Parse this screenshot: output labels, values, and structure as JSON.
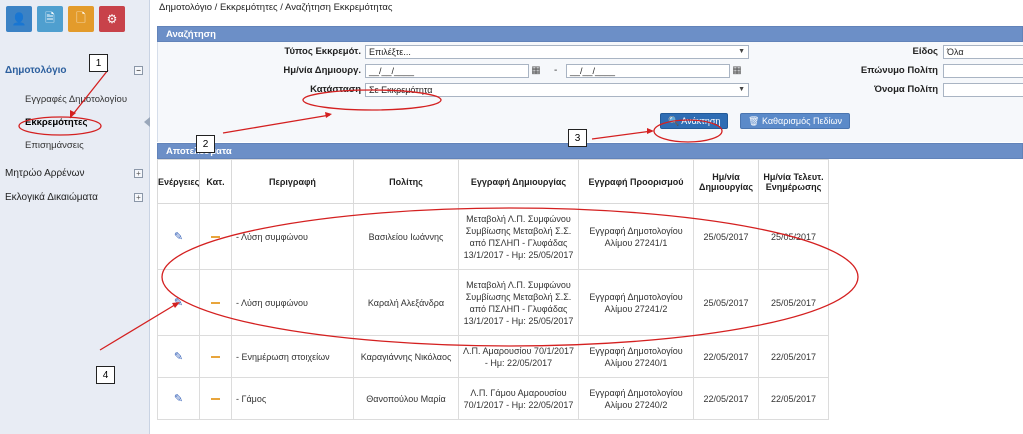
{
  "sidebar": {
    "top_icons": [
      {
        "icon": "user-icon",
        "glyph": "👤",
        "color": "blue"
      },
      {
        "icon": "document-icon",
        "glyph": "🗎",
        "color": "teal"
      },
      {
        "icon": "file-icon",
        "glyph": "🗋",
        "color": "orange"
      },
      {
        "icon": "settings-icon",
        "glyph": "⚙",
        "color": "red"
      }
    ],
    "main_menu_label": "Δημοτολόγιο",
    "sub_items": [
      {
        "label": "Εγγραφές Δημοτολογίου"
      },
      {
        "label": "Εκκρεμότητες"
      },
      {
        "label": "Επισημάνσεις"
      }
    ],
    "other_menus": [
      {
        "label": "Μητρώο Αρρένων"
      },
      {
        "label": "Εκλογικά Δικαιώματα"
      }
    ],
    "toggle_sign": "⊟",
    "toggle_plus": "⊞"
  },
  "breadcrumb": {
    "item1": "Δημοτολόγιο",
    "sep": "/",
    "item2": "Εκκρεμότητες",
    "item3": "Αναζήτηση Εκκρεμότητας"
  },
  "search": {
    "header": "Αναζήτηση",
    "type_label": "Τύπος Εκκρεμότ.",
    "type_value": "Επιλέξτε...",
    "date_label": "Ημ/νία Δημιουργ.",
    "date_from": "__/__/____",
    "date_to": "__/__/____",
    "date_dash": "-",
    "status_label": "Κατάσταση",
    "status_value": "Σε Εκκρεμότητα",
    "kind_label": "Είδος",
    "kind_value": "Όλα",
    "surname_label": "Επώνυμο Πολίτη",
    "name_label": "Όνομα Πολίτη",
    "search_button": "Ανάκτηση",
    "clear_button": "Καθαρισμός Πεδίων"
  },
  "results": {
    "header": "Αποτελέσματα",
    "columns": [
      "Ενέργειες",
      "Κατ.",
      "Περιγραφή",
      "Πολίτης",
      "Εγγραφή Δημιουργίας",
      "Εγγραφή Προορισμού",
      "Ημ/νία Δημιουργίας",
      "Ημ/νία Τελευτ. Ενημέρωσης"
    ],
    "rows": [
      {
        "desc": "- Λύση συμφώνου",
        "citizen": "Βασιλείου Ιωάννης",
        "created": "Μεταβολή Λ.Π. Συμφώνου Συμβίωσης Μεταβολή Σ.Σ. από ΠΣΛΗΠ - Γλυφάδας 13/1/2017 - Ημ: 25/05/2017",
        "dest": "Εγγραφή Δημοτολογίου Αλίμου 27241/1",
        "date_created": "25/05/2017",
        "date_updated": "25/05/2017"
      },
      {
        "desc": "- Λύση συμφώνου",
        "citizen": "Καραλή Αλεξάνδρα",
        "created": "Μεταβολή Λ.Π. Συμφώνου Συμβίωσης Μεταβολή Σ.Σ. από ΠΣΛΗΠ - Γλυφάδας 13/1/2017 - Ημ: 25/05/2017",
        "dest": "Εγγραφή Δημοτολογίου Αλίμου 27241/2",
        "date_created": "25/05/2017",
        "date_updated": "25/05/2017"
      },
      {
        "desc": "- Ενημέρωση στοιχείων",
        "citizen": "Καραγιάννης Νικόλαος",
        "created": "Λ.Π. Αμαρουσίου 70/1/2017 - Ημ: 22/05/2017",
        "dest": "Εγγραφή Δημοτολογίου Αλίμου 27240/1",
        "date_created": "22/05/2017",
        "date_updated": "22/05/2017"
      },
      {
        "desc": "- Γάμος",
        "citizen": "Θανοπούλου Μαρία",
        "created": "Λ.Π. Γάμου Αμαρουσίου 70/1/2017 - Ημ: 22/05/2017",
        "dest": "Εγγραφή Δημοτολογίου Αλίμου 27240/2",
        "date_created": "22/05/2017",
        "date_updated": "22/05/2017"
      }
    ]
  },
  "annotations": {
    "n1": "1",
    "n2": "2",
    "n3": "3",
    "n4": "4"
  },
  "colors": {
    "panel_header": "#6c8fc7",
    "primary_button": "#2f6db4",
    "annotation_red": "#d42020"
  }
}
